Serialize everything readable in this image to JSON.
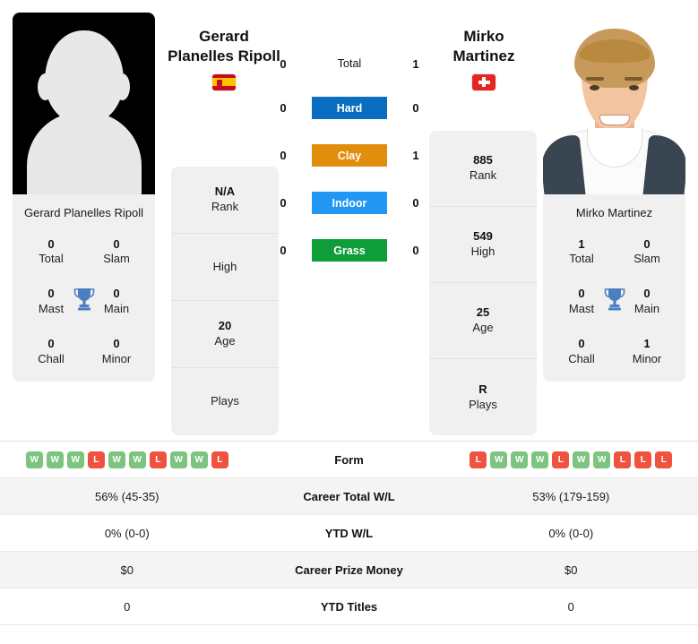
{
  "players": {
    "left": {
      "first_name": "Gerard",
      "last_name": "Planelles Ripoll",
      "full_name": "Gerard Planelles Ripoll",
      "country_code": "ES",
      "flag_name": "spain-flag",
      "photo_type": "silhouette-placeholder",
      "info": [
        {
          "value": "N/A",
          "label": "Rank"
        },
        {
          "value": "",
          "label": "High"
        },
        {
          "value": "20",
          "label": "Age"
        },
        {
          "value": "",
          "label": "Plays"
        }
      ],
      "titles": [
        {
          "value": "0",
          "label": "Total"
        },
        {
          "value": "0",
          "label": "Slam"
        },
        {
          "value": "0",
          "label": "Mast"
        },
        {
          "value": "0",
          "label": "Main"
        },
        {
          "value": "0",
          "label": "Chall"
        },
        {
          "value": "0",
          "label": "Minor"
        }
      ],
      "h2h": {
        "total": "0",
        "hard": "0",
        "clay": "0",
        "indoor": "0",
        "grass": "0"
      },
      "form": [
        "W",
        "W",
        "W",
        "L",
        "W",
        "W",
        "L",
        "W",
        "W",
        "L"
      ],
      "career_total_wl": "56% (45-35)",
      "ytd_wl": "0% (0-0)",
      "career_prize_money": "$0",
      "ytd_titles": "0"
    },
    "right": {
      "first_name": "Mirko",
      "last_name": "Martinez",
      "full_name": "Mirko Martinez",
      "country_code": "CH",
      "flag_name": "switzerland-flag",
      "photo_type": "player-headshot",
      "info": [
        {
          "value": "885",
          "label": "Rank"
        },
        {
          "value": "549",
          "label": "High"
        },
        {
          "value": "25",
          "label": "Age"
        },
        {
          "value": "R",
          "label": "Plays"
        }
      ],
      "titles": [
        {
          "value": "1",
          "label": "Total"
        },
        {
          "value": "0",
          "label": "Slam"
        },
        {
          "value": "0",
          "label": "Mast"
        },
        {
          "value": "0",
          "label": "Main"
        },
        {
          "value": "0",
          "label": "Chall"
        },
        {
          "value": "1",
          "label": "Minor"
        }
      ],
      "h2h": {
        "total": "1",
        "hard": "0",
        "clay": "1",
        "indoor": "0",
        "grass": "0"
      },
      "form": [
        "L",
        "W",
        "W",
        "W",
        "L",
        "W",
        "W",
        "L",
        "L",
        "L"
      ],
      "career_total_wl": "53% (179-159)",
      "ytd_wl": "0% (0-0)",
      "career_prize_money": "$0",
      "ytd_titles": "0"
    }
  },
  "surfaces": [
    {
      "key": "total",
      "label": "Total",
      "color": "transparent",
      "text_color": "#111111"
    },
    {
      "key": "hard",
      "label": "Hard",
      "color": "#0b6dc0",
      "text_color": "#ffffff"
    },
    {
      "key": "clay",
      "label": "Clay",
      "color": "#e08e0b",
      "text_color": "#ffffff"
    },
    {
      "key": "indoor",
      "label": "Indoor",
      "color": "#2196f3",
      "text_color": "#ffffff"
    },
    {
      "key": "grass",
      "label": "Grass",
      "color": "#0f9d3a",
      "text_color": "#ffffff"
    }
  ],
  "stats_rows": [
    {
      "key": "form",
      "label": "Form",
      "type": "form"
    },
    {
      "key": "career_total_wl",
      "label": "Career Total W/L",
      "type": "text"
    },
    {
      "key": "ytd_wl",
      "label": "YTD W/L",
      "type": "text"
    },
    {
      "key": "career_prize_money",
      "label": "Career Prize Money",
      "type": "text"
    },
    {
      "key": "ytd_titles",
      "label": "YTD Titles",
      "type": "text"
    }
  ],
  "colors": {
    "win_badge": "#7cc47f",
    "loss_badge": "#ef5340",
    "trophy": "#4a7fc1",
    "card_bg": "#f0f0f0",
    "row_shade": "#f4f4f4"
  }
}
